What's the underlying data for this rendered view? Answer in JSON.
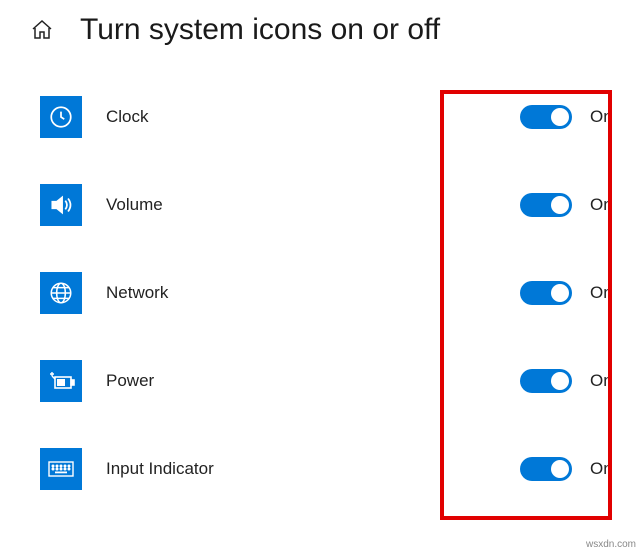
{
  "header": {
    "title": "Turn system icons on or off"
  },
  "items": [
    {
      "icon": "clock-icon",
      "label": "Clock",
      "state": "On"
    },
    {
      "icon": "volume-icon",
      "label": "Volume",
      "state": "On"
    },
    {
      "icon": "network-icon",
      "label": "Network",
      "state": "On"
    },
    {
      "icon": "power-icon",
      "label": "Power",
      "state": "On"
    },
    {
      "icon": "keyboard-icon",
      "label": "Input Indicator",
      "state": "On"
    }
  ],
  "watermark": "wsxdn.com",
  "colors": {
    "accent": "#0078d7",
    "highlight": "#e10000"
  }
}
